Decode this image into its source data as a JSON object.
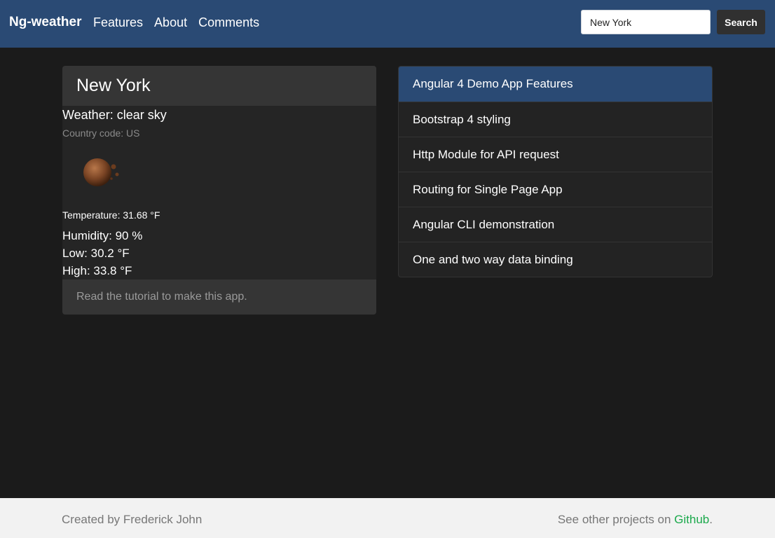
{
  "navbar": {
    "brand": "Ng-weather",
    "links": [
      "Features",
      "About",
      "Comments"
    ],
    "search": {
      "value": "New York",
      "button_label": "Search"
    }
  },
  "weather": {
    "city": "New York",
    "description": "Weather: clear sky",
    "country": "Country code: US",
    "icon": "clear-sky-icon",
    "temperature": "Temperature: 31.68 °F",
    "humidity": "Humidity: 90 %",
    "low": "Low: 30.2 °F",
    "high": "High: 33.8 °F",
    "footer": "Read the tutorial to make this app."
  },
  "features": {
    "items": [
      "Angular 4 Demo App Features",
      "Bootstrap 4 styling",
      "Http Module for API request",
      "Routing for Single Page App",
      "Angular CLI demonstration",
      "One and two way data binding"
    ]
  },
  "footer": {
    "created_by": "Created by Frederick John",
    "see_other": "See other projects on ",
    "github": "Github",
    "period": "."
  },
  "colors": {
    "navbar": "#2a4a74",
    "link_green": "#1ba94c",
    "background": "#1b1b1b"
  }
}
